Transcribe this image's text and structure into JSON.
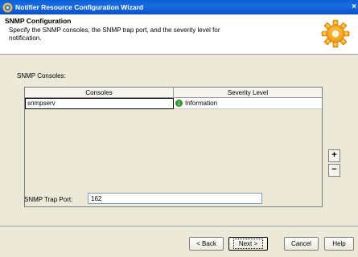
{
  "window": {
    "title": "Notifier Resource Configuration Wizard",
    "close_symbol": "×"
  },
  "header": {
    "title": "SNMP Configuration",
    "description": "Specify the SNMP consoles, the SNMP trap port, and the severity level for notification."
  },
  "consoles": {
    "label": "SNMP Consoles:",
    "columns": [
      "Consoles",
      "Severity Level"
    ],
    "rows": [
      {
        "console": "snmpserv",
        "severity": "Information"
      }
    ],
    "add_symbol": "+",
    "remove_symbol": "−"
  },
  "trap_port": {
    "label": "SNMP Trap Port:",
    "value": "162"
  },
  "buttons": {
    "back": "< Back",
    "next": "Next >",
    "cancel": "Cancel",
    "help": "Help"
  },
  "icons": {
    "app": "wizard-app-icon",
    "header": "gear-icon",
    "severity": "info-icon"
  },
  "colors": {
    "titlebar": "#0a5fd6",
    "dialog_bg": "#ece9d8",
    "info_green": "#2e9b2e",
    "gear_orange": "#f3a31c"
  }
}
